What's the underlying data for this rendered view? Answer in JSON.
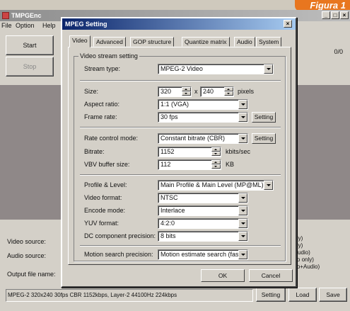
{
  "badge": "Figura 1",
  "main_window": {
    "title": "TMPGEnc",
    "menu": [
      "File",
      "Option",
      "Help"
    ],
    "start_button": "Start",
    "stop_button": "Stop",
    "counter": "0/0",
    "labels": {
      "video_source": "Video source:",
      "audio_source": "Audio source:",
      "output_file": "Output file name:"
    },
    "right_list": [
      "only)",
      "only)",
      "+Audio)",
      "deo only)",
      "deo+Audio)"
    ],
    "status": "MPEG-2 320x240 30fps CBR 1152kbps, Layer-2 44100Hz 224kbps",
    "setting_button": "Setting",
    "load_button": "Load",
    "save_button": "Save"
  },
  "dialog": {
    "title": "MPEG Setting",
    "tabs": [
      "Video",
      "Advanced",
      "GOP structure",
      "Quantize matrix",
      "Audio",
      "System"
    ],
    "group_title": "Video stream setting",
    "fields": {
      "stream_type": {
        "label": "Stream type:",
        "value": "MPEG-2 Video"
      },
      "size": {
        "label": "Size:",
        "width": "320",
        "x": "x",
        "height": "240",
        "unit": "pixels"
      },
      "aspect": {
        "label": "Aspect ratio:",
        "value": "1:1 (VGA)"
      },
      "frame_rate": {
        "label": "Frame rate:",
        "value": "30 fps",
        "button": "Setting"
      },
      "rate_control": {
        "label": "Rate control mode:",
        "value": "Constant bitrate (CBR)",
        "button": "Setting"
      },
      "bitrate": {
        "label": "Bitrate:",
        "value": "1152",
        "unit": "kbits/sec"
      },
      "vbv": {
        "label": "VBV buffer size:",
        "value": "112",
        "unit": "KB"
      },
      "profile": {
        "label": "Profile & Level:",
        "value": "Main Profile & Main Level (MP@ML)"
      },
      "video_format": {
        "label": "Video format:",
        "value": "NTSC"
      },
      "encode_mode": {
        "label": "Encode mode:",
        "value": "Interlace"
      },
      "yuv": {
        "label": "YUV format:",
        "value": "4:2:0"
      },
      "dc": {
        "label": "DC component precision:",
        "value": "8 bits"
      },
      "motion": {
        "label": "Motion search precision:",
        "value": "Motion estimate search (fast)"
      }
    },
    "ok_button": "OK",
    "cancel_button": "Cancel"
  }
}
